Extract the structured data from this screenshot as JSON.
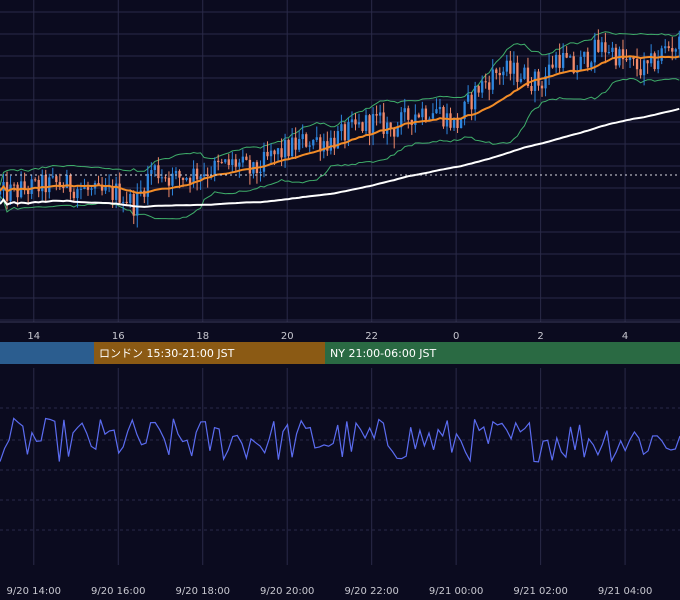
{
  "chart_data": [
    {
      "type": "candlestick",
      "panel": "price",
      "x_tick_labels": [
        "14",
        "16",
        "18",
        "20",
        "22",
        "0",
        "2",
        "4"
      ],
      "x_tick_hours": [
        14,
        16,
        18,
        20,
        22,
        24,
        26,
        28
      ],
      "x_range_hours": [
        13.2,
        29.3
      ],
      "current_price_line": "dotted",
      "candle_interval_min": 5,
      "overlays": [
        {
          "name": "",
          "kind": "moving-average-short",
          "color": "#f28c28"
        },
        {
          "name": "",
          "kind": "moving-average-long",
          "color": "#ffffff"
        },
        {
          "name": "",
          "kind": "bollinger-bands",
          "color": "#3fae6a"
        }
      ],
      "candle_colors": {
        "up": "#2e86de",
        "down": "#f08a6a"
      },
      "price_path_knots": {
        "hours": [
          13.2,
          13.8,
          14.5,
          15.0,
          15.5,
          16.0,
          16.4,
          16.8,
          17.3,
          17.8,
          18.3,
          18.8,
          19.2,
          19.6,
          20.0,
          20.5,
          21.0,
          21.5,
          22.0,
          22.5,
          23.0,
          23.5,
          24.0,
          24.5,
          25.0,
          25.5,
          26.0,
          26.4,
          26.8,
          27.2,
          27.6,
          28.0,
          28.5,
          29.0,
          29.3
        ],
        "values": [
          0.4,
          0.42,
          0.44,
          0.43,
          0.4,
          0.41,
          0.36,
          0.5,
          0.46,
          0.48,
          0.5,
          0.52,
          0.48,
          0.54,
          0.57,
          0.61,
          0.6,
          0.64,
          0.68,
          0.65,
          0.71,
          0.73,
          0.66,
          0.8,
          0.87,
          0.86,
          0.82,
          0.93,
          0.87,
          0.94,
          0.96,
          0.9,
          0.87,
          0.96,
          0.97
        ]
      }
    },
    {
      "type": "line",
      "panel": "oscillator",
      "series": [
        {
          "name": "",
          "color": "#5b6cf0",
          "samples": 150,
          "mean": 0.5,
          "amplitude": 0.5
        }
      ],
      "grid": true
    }
  ],
  "sessions": [
    {
      "label": "",
      "color": "#2b5d8f"
    },
    {
      "label": "ロンドン 15:30-21:00 JST",
      "color": "#8b5a14"
    },
    {
      "label": "NY 21:00-06:00 JST",
      "color": "#2a6a43"
    }
  ],
  "date_labels": [
    "9/20 14:00",
    "9/20 16:00",
    "9/20 18:00",
    "9/20 20:00",
    "9/20 22:00",
    "9/21 00:00",
    "9/21 02:00",
    "9/21 04:00"
  ],
  "colors": {
    "background": "#0b0b1f",
    "grid": "#2a2a48",
    "text": "#c8c8d0"
  }
}
